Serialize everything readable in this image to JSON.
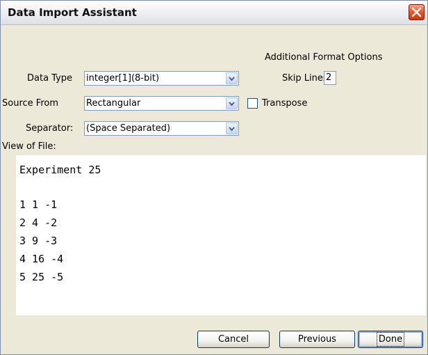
{
  "window": {
    "title": "Data Import Assistant"
  },
  "additional_format_options": "Additional Format Options",
  "data_type": {
    "label": "Data Type",
    "value": "integer[1](8-bit)"
  },
  "source_from": {
    "label": "Source From",
    "value": "Rectangular"
  },
  "separator": {
    "label": "Separator:",
    "value": "(Space Separated)"
  },
  "skip_lines": {
    "label": "Skip Lines",
    "value": "2"
  },
  "transpose": {
    "label": "Transpose",
    "checked": false
  },
  "view_of_file": {
    "label": "View of File:",
    "lines": [
      "Experiment 25",
      "",
      "1 1 -1",
      "2 4 -2",
      "3 9 -3",
      "4 16 -4",
      "5 25 -5"
    ]
  },
  "buttons": {
    "cancel": "Cancel",
    "previous": "Previous",
    "done": "Done"
  }
}
